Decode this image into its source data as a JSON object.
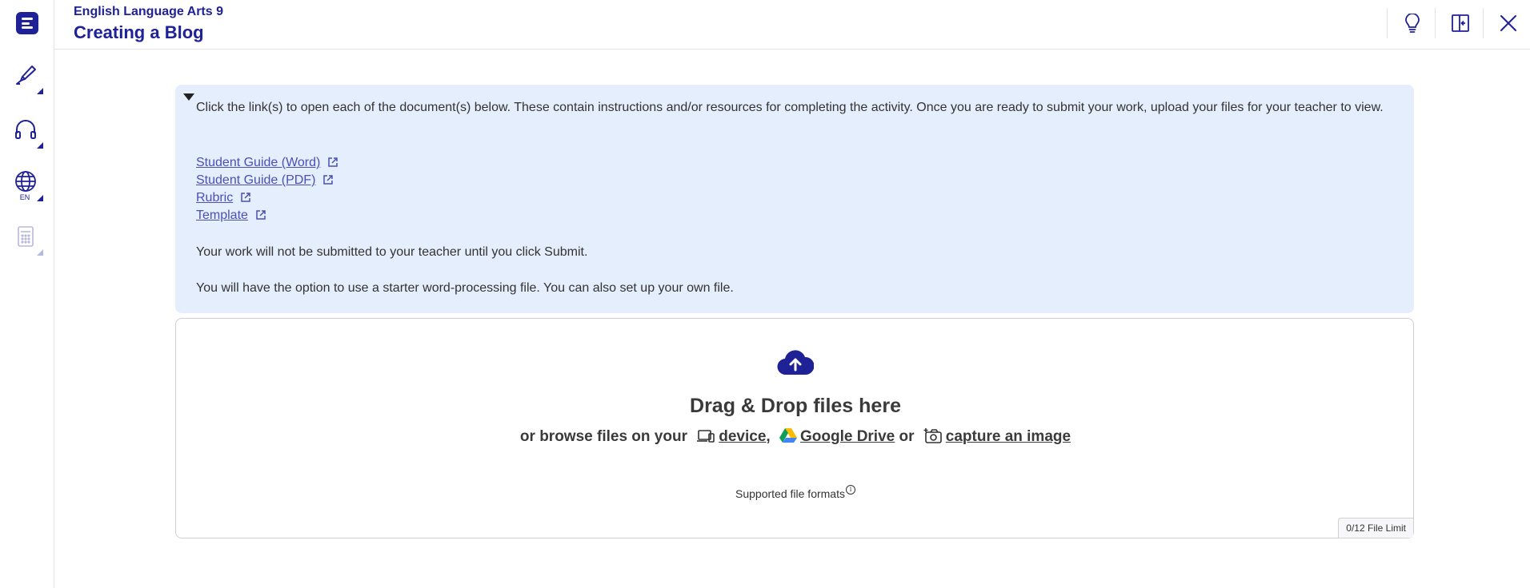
{
  "header": {
    "course": "English Language Arts 9",
    "title": "Creating a Blog"
  },
  "rail": {
    "tools": [
      {
        "icon": "highlighter-icon"
      },
      {
        "icon": "headphones-icon"
      },
      {
        "icon": "globe-icon",
        "label": "EN"
      },
      {
        "icon": "calculator-icon",
        "disabled": true
      }
    ]
  },
  "header_actions": [
    {
      "icon": "lightbulb-icon"
    },
    {
      "icon": "collapse-panel-icon"
    },
    {
      "icon": "close-icon"
    }
  ],
  "instructions": {
    "intro": "Click the link(s) to open each of the document(s) below. These contain instructions and/or resources for completing the activity. Once you are ready to submit your work, upload your files for your teacher to view.",
    "links": [
      "Student Guide (Word)",
      "Student Guide (PDF)",
      "Rubric",
      "Template"
    ],
    "note1": "Your work will not be submitted to your teacher until you click Submit.",
    "note2": "You will have the option to use a starter word-processing file. You can also set up your own file."
  },
  "upload": {
    "title": "Drag & Drop files here",
    "browse_prefix": "or browse files on your",
    "device": "device",
    "comma": ",",
    "google_drive": "Google Drive",
    "or": "or",
    "capture": "capture an image",
    "formats": "Supported file formats",
    "limit": "0/12 File Limit"
  },
  "colors": {
    "brand": "#1f2196",
    "instructions_bg": "#e5eefc",
    "link": "#4b4fb6"
  }
}
